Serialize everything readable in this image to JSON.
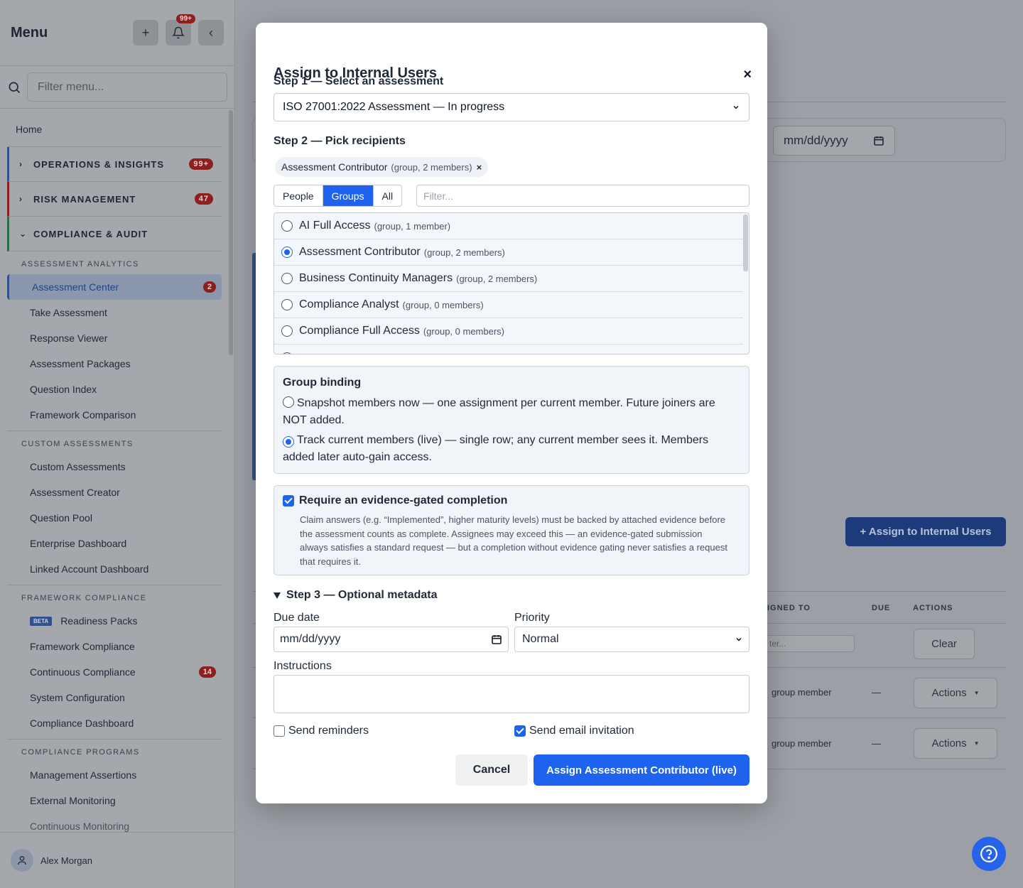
{
  "sidebar": {
    "title": "Menu",
    "notification_count": "99+",
    "filter_placeholder": "Filter menu...",
    "home": "Home",
    "sections": [
      {
        "label": "OPERATIONS & INSIGHTS",
        "badge": "99+",
        "color": "#31518c"
      },
      {
        "label": "RISK MANAGEMENT",
        "badge": "47",
        "color": "#8e1f1f"
      },
      {
        "label": "COMPLIANCE & AUDIT",
        "badge": "",
        "color": "#2f6b4d"
      }
    ],
    "groups": {
      "assessment_analytics": "ASSESSMENT ANALYTICS",
      "custom_assessments": "CUSTOM ASSESSMENTS",
      "framework_compliance": "FRAMEWORK COMPLIANCE",
      "compliance_programs": "COMPLIANCE PROGRAMS"
    },
    "items": {
      "assessment_center": "Assessment Center",
      "assessment_center_badge": "2",
      "take_assessment": "Take Assessment",
      "response_viewer": "Response Viewer",
      "assessment_packages": "Assessment Packages",
      "question_index": "Question Index",
      "framework_comparison": "Framework Comparison",
      "custom_assessments": "Custom Assessments",
      "assessment_creator": "Assessment Creator",
      "question_pool": "Question Pool",
      "enterprise_dashboard": "Enterprise Dashboard",
      "linked_account_dashboard": "Linked Account Dashboard",
      "beta_label": "BETA",
      "readiness_packs": "Readiness Packs",
      "framework_compliance": "Framework Compliance",
      "continuous_compliance": "Continuous Compliance",
      "continuous_compliance_badge": "14",
      "system_configuration": "System Configuration",
      "compliance_dashboard": "Compliance Dashboard",
      "management_assertions": "Management Assertions",
      "external_monitoring": "External Monitoring",
      "continuous_monitoring": "Continuous Monitoring"
    },
    "user_name": "Alex Morgan"
  },
  "background": {
    "date_placeholder": "mm/dd/yyyy",
    "assign_button": "+ Assign to Internal Users",
    "col_assigned_to": "IGNED TO",
    "col_due": "DUE",
    "col_actions": "ACTIONS",
    "col_filter_placeholder": "ter...",
    "clear_button": "Clear",
    "rows": [
      {
        "assigned": "group member",
        "due": "—",
        "actions": "Actions"
      },
      {
        "assigned": "group member",
        "due": "—",
        "actions": "Actions"
      }
    ]
  },
  "modal": {
    "title": "Assign to Internal Users",
    "step1_label": "Step 1 — Select an assessment",
    "assessment_selected": "ISO 27001:2022 Assessment — In progress",
    "step2_label": "Step 2 — Pick recipients",
    "chip_name": "Assessment Contributor",
    "chip_meta": "(group, 2 members)",
    "tabs": [
      "People",
      "Groups",
      "All"
    ],
    "active_tab": "Groups",
    "filter_placeholder": "Filter...",
    "recipients": [
      {
        "name": "AI Full Access",
        "meta": "(group, 1 member)",
        "selected": false
      },
      {
        "name": "Assessment Contributor",
        "meta": "(group, 2 members)",
        "selected": true
      },
      {
        "name": "Business Continuity Managers",
        "meta": "(group, 2 members)",
        "selected": false
      },
      {
        "name": "Compliance Analyst",
        "meta": "(group, 0 members)",
        "selected": false
      },
      {
        "name": "Compliance Full Access",
        "meta": "(group, 0 members)",
        "selected": false
      }
    ],
    "group_binding": {
      "title": "Group binding",
      "snapshot_label": "Snapshot members now — one assignment per current member. Future joiners are NOT added.",
      "track_label": "Track current members (live) — single row; any current member sees it. Members added later auto-gain access.",
      "selected": "track"
    },
    "evidence": {
      "title": "Require an evidence-gated completion",
      "checked": true,
      "description": "Claim answers (e.g. “Implemented”, higher maturity levels) must be backed by attached evidence before the assessment counts as complete. Assignees may exceed this — an evidence-gated submission always satisfies a standard request — but a completion without evidence gating never satisfies a request that requires it."
    },
    "step3_label": "Step 3 — Optional metadata",
    "due_date_label": "Due date",
    "due_date_placeholder": "mm/dd/yyyy",
    "priority_label": "Priority",
    "priority_value": "Normal",
    "instructions_label": "Instructions",
    "send_reminders_label": "Send reminders",
    "send_reminders_checked": false,
    "send_email_label": "Send email invitation",
    "send_email_checked": true,
    "cancel_label": "Cancel",
    "submit_label": "Assign Assessment Contributor (live)"
  }
}
